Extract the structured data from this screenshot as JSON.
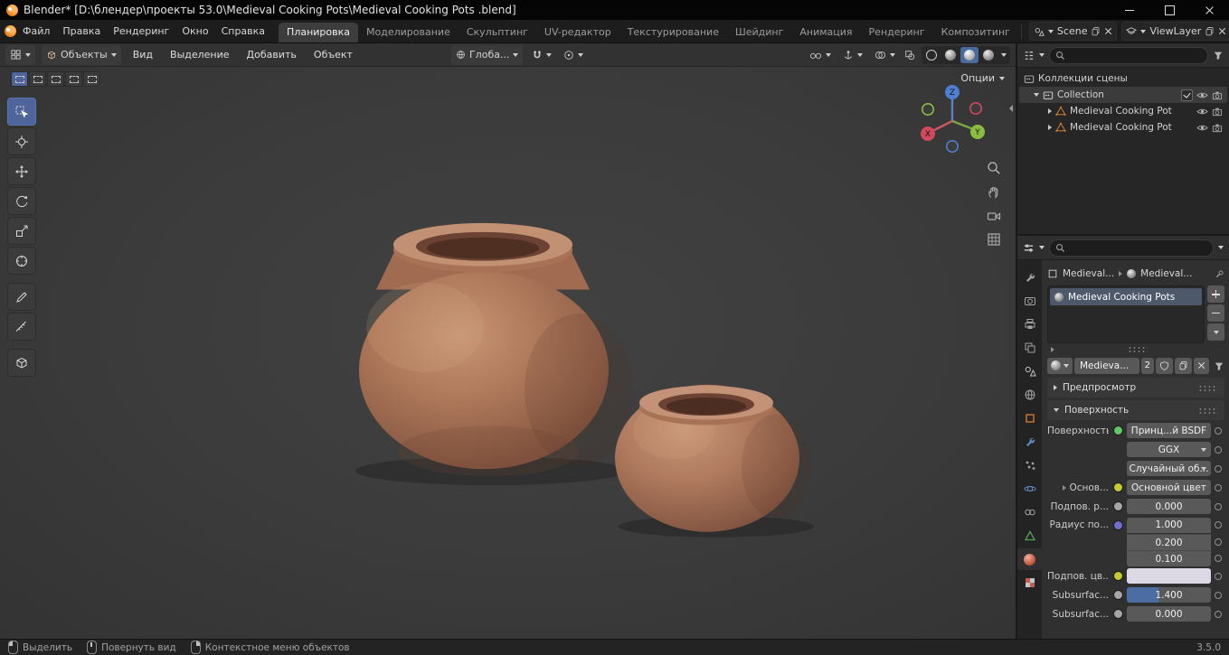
{
  "window": {
    "title": "Blender* [D:\\блендер\\проекты 53.0\\Medieval Cooking Pots\\Medieval Cooking Pots .blend]"
  },
  "topbar": {
    "menus": [
      "Файл",
      "Правка",
      "Рендеринг",
      "Окно",
      "Справка"
    ],
    "workspaces": [
      "Планировка",
      "Моделирование",
      "Скульптинг",
      "UV-редактор",
      "Текстурирование",
      "Шейдинг",
      "Анимация",
      "Рендеринг",
      "Композитинг"
    ],
    "scene_name": "Scene",
    "view_layer_name": "ViewLayer"
  },
  "viewport": {
    "mode": "Объекты",
    "menus": [
      "Вид",
      "Выделение",
      "Добавить",
      "Объект"
    ],
    "orientation": "Глоба...",
    "options_label": "Опции",
    "axis": {
      "x": "X",
      "y": "Y",
      "z": "Z"
    }
  },
  "outliner": {
    "scene_collection": "Коллекции сцены",
    "collection": "Collection",
    "objects": [
      "Medieval Cooking Pot",
      "Medieval Cooking Pot"
    ]
  },
  "properties": {
    "breadcrumb": {
      "object": "Medieval...",
      "material": "Medieval..."
    },
    "slot_name": "Medieval Cooking Pots",
    "material_name": "Medieva...",
    "users": "2",
    "panels": {
      "preview": "Предпросмотр",
      "surface": "Поверхность"
    },
    "surface": {
      "surface_label": "Поверхность",
      "shader": "Принц...й BSDF",
      "distribution": "GGX",
      "sss_method": "Случайный об...",
      "base_label": "Основ...",
      "base_value": "Основной цвет",
      "sss_weight_label": "Подпов. р...",
      "sss_weight": "0.000",
      "radius_label": "Радиус по...",
      "radius_x": "1.000",
      "radius_y": "0.200",
      "radius_z": "0.100",
      "sss_color_label": "Подпов. цв...",
      "sss_ior_label": "Subsurfac...",
      "sss_ior": "1.400",
      "sss_aniso_label": "Subsurfac...",
      "sss_aniso": "0.000"
    }
  },
  "statusbar": {
    "select": "Выделить",
    "rotate_view": "Повернуть вид",
    "context_menu": "Контекстное меню объектов",
    "version": "3.5.0"
  }
}
